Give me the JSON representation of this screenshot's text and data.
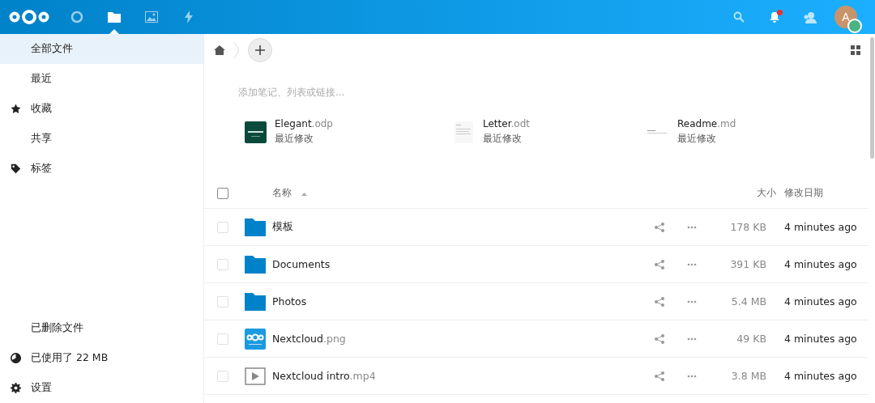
{
  "header": {
    "apps": [
      {
        "kind": "dashboard",
        "selected": false
      },
      {
        "kind": "files",
        "selected": true
      },
      {
        "kind": "photos",
        "selected": false
      },
      {
        "kind": "activity",
        "selected": false
      }
    ],
    "notification_badge": true,
    "avatar_letter": "A",
    "status_online": true
  },
  "sidebar": {
    "items": [
      {
        "label": "全部文件",
        "kind": "plain",
        "selected": true
      },
      {
        "label": "最近",
        "kind": "plain",
        "selected": false
      },
      {
        "label": "收藏",
        "kind": "favorites",
        "selected": false
      },
      {
        "label": "共享",
        "kind": "plain",
        "selected": false
      },
      {
        "label": "标签",
        "kind": "tags",
        "selected": false
      }
    ],
    "footer": [
      {
        "label": "已删除文件",
        "kind": "plain"
      },
      {
        "label": "已使用了 22 MB",
        "kind": "quota"
      },
      {
        "label": "设置",
        "kind": "settings"
      }
    ]
  },
  "note_placeholder": "添加笔记、列表或链接...",
  "recent": [
    {
      "name": "Elegant",
      "ext": ".odp",
      "subtitle": "最近修改",
      "kind": "slides"
    },
    {
      "name": "Letter",
      "ext": ".odt",
      "subtitle": "最近修改",
      "kind": "document"
    },
    {
      "name": "Readme",
      "ext": ".md",
      "subtitle": "最近修改",
      "kind": "text"
    }
  ],
  "table": {
    "select_all_checked": false,
    "columns": {
      "name": "名称",
      "size": "大小",
      "modified": "修改日期"
    },
    "rows": [
      {
        "name": "模板",
        "checked": false,
        "kind": "folder",
        "size": "178 KB",
        "modified": "4 minutes ago"
      },
      {
        "name": "Documents",
        "checked": false,
        "kind": "folder",
        "size": "391 KB",
        "modified": "4 minutes ago"
      },
      {
        "name": "Photos",
        "checked": false,
        "kind": "folder",
        "size": "5.4 MB",
        "modified": "4 minutes ago"
      },
      {
        "name": "Nextcloud",
        "ext": ".png",
        "checked": false,
        "kind": "image",
        "size": "49 KB",
        "modified": "4 minutes ago"
      },
      {
        "name": "Nextcloud intro",
        "ext": ".mp4",
        "checked": false,
        "kind": "video",
        "size": "3.8 MB",
        "modified": "4 minutes ago"
      }
    ]
  }
}
